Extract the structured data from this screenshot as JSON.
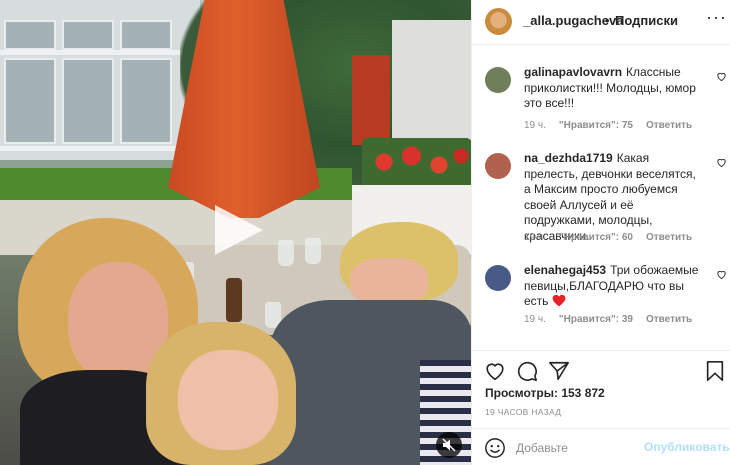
{
  "header": {
    "username": "_alla.pugacheva",
    "separator": "•",
    "follow_label": "Подписки",
    "more_label": "···"
  },
  "comments": [
    {
      "username": "galinapavlovavrn",
      "text": "Классные приколистки!!! Молодцы, юмор это все!!!",
      "time": "19 ч.",
      "likes": "\"Нравится\": 75",
      "reply": "Ответить",
      "avatar_color": "#6f7f5c"
    },
    {
      "username": "na_dezhda1719",
      "text": "Какая прелесть, девчонки веселятся, а Максим просто любуемся своей Аллусей и её подружками, молодцы, красавчики.",
      "time": "19 ч.",
      "likes": "\"Нравится\": 60",
      "reply": "Ответить",
      "avatar_color": "#b0624e"
    },
    {
      "username": "elenahegaj453",
      "text": "Три обожаемые певицы,БЛАГОДАРЮ что вы есть",
      "time": "19 ч.",
      "likes": "\"Нравится\": 39",
      "reply": "Ответить",
      "avatar_color": "#4a5a86"
    }
  ],
  "stats": {
    "views": "Просмотры: 153 872",
    "posted": "19 ЧАСОВ НАЗАД"
  },
  "add_comment": {
    "placeholder": "Добавьте",
    "publish_label": "Опубликовать"
  },
  "colors": {
    "link_disabled": "#b2dffc",
    "meta_gray": "#8e8e8e",
    "heart_red": "#ed4956"
  },
  "icons": [
    "play-icon",
    "mute-icon",
    "more-icon",
    "heart-icon",
    "comment-icon",
    "share-icon",
    "bookmark-icon",
    "emoji-icon"
  ]
}
